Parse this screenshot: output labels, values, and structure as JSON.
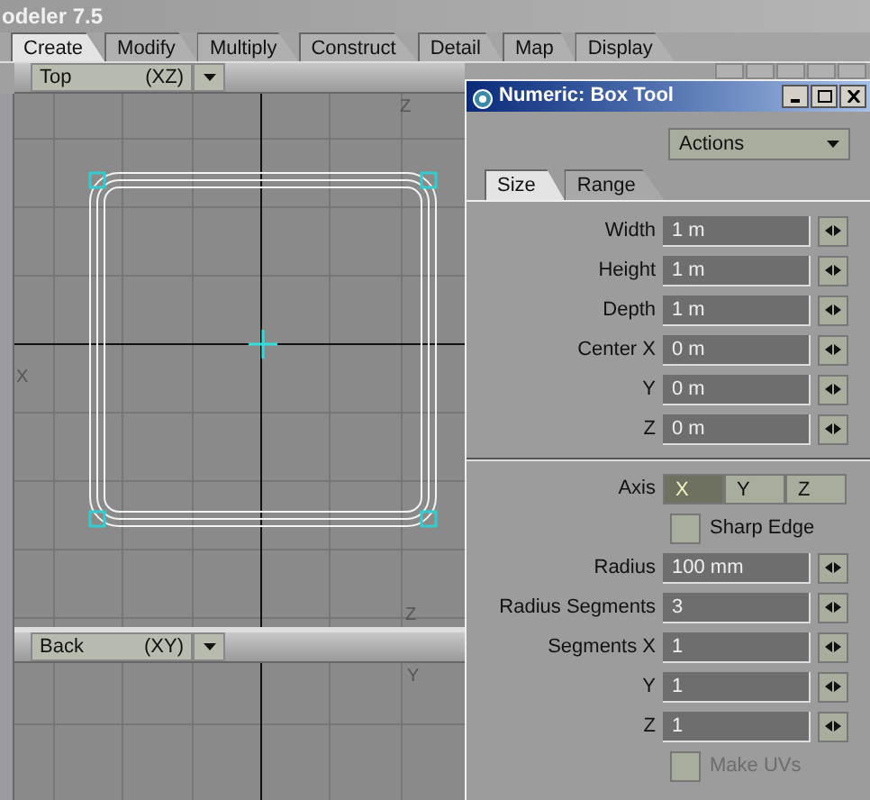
{
  "app": {
    "title": "odeler 7.5"
  },
  "tabs": [
    {
      "label": "Create",
      "selected": true
    },
    {
      "label": "Modify",
      "selected": false
    },
    {
      "label": "Multiply",
      "selected": false
    },
    {
      "label": "Construct",
      "selected": false
    },
    {
      "label": "Detail",
      "selected": false
    },
    {
      "label": "Map",
      "selected": false
    },
    {
      "label": "Display",
      "selected": false
    }
  ],
  "top_viewport": {
    "view": "Top",
    "projection": "(XZ)",
    "axis_top": "Z",
    "axis_left": "X",
    "axis_bottom": "Z"
  },
  "bottom_viewport": {
    "view": "Back",
    "projection": "(XY)",
    "axis_top": "Y"
  },
  "dialog": {
    "title": "Numeric: Box Tool",
    "actions": "Actions",
    "tabs": [
      {
        "label": "Size",
        "selected": true
      },
      {
        "label": "Range",
        "selected": false
      }
    ],
    "fields": [
      {
        "label": "Width",
        "value": "1 m"
      },
      {
        "label": "Height",
        "value": "1 m"
      },
      {
        "label": "Depth",
        "value": "1 m"
      },
      {
        "label": "Center X",
        "value": "0 m"
      },
      {
        "label": "Y",
        "value": "0 m"
      },
      {
        "label": "Z",
        "value": "0 m"
      }
    ],
    "axis": {
      "label": "Axis",
      "options": [
        {
          "label": "X",
          "selected": true
        },
        {
          "label": "Y",
          "selected": false
        },
        {
          "label": "Z",
          "selected": false
        }
      ]
    },
    "sharp_edge": {
      "label": "Sharp Edge",
      "checked": false
    },
    "fields2": [
      {
        "label": "Radius",
        "value": "100 mm"
      },
      {
        "label": "Radius Segments",
        "value": "3"
      },
      {
        "label": "Segments X",
        "value": "1"
      },
      {
        "label": "Y",
        "value": "1"
      },
      {
        "label": "Z",
        "value": "1"
      }
    ],
    "make_uvs": {
      "label": "Make UVs",
      "checked": false,
      "disabled": true
    }
  }
}
